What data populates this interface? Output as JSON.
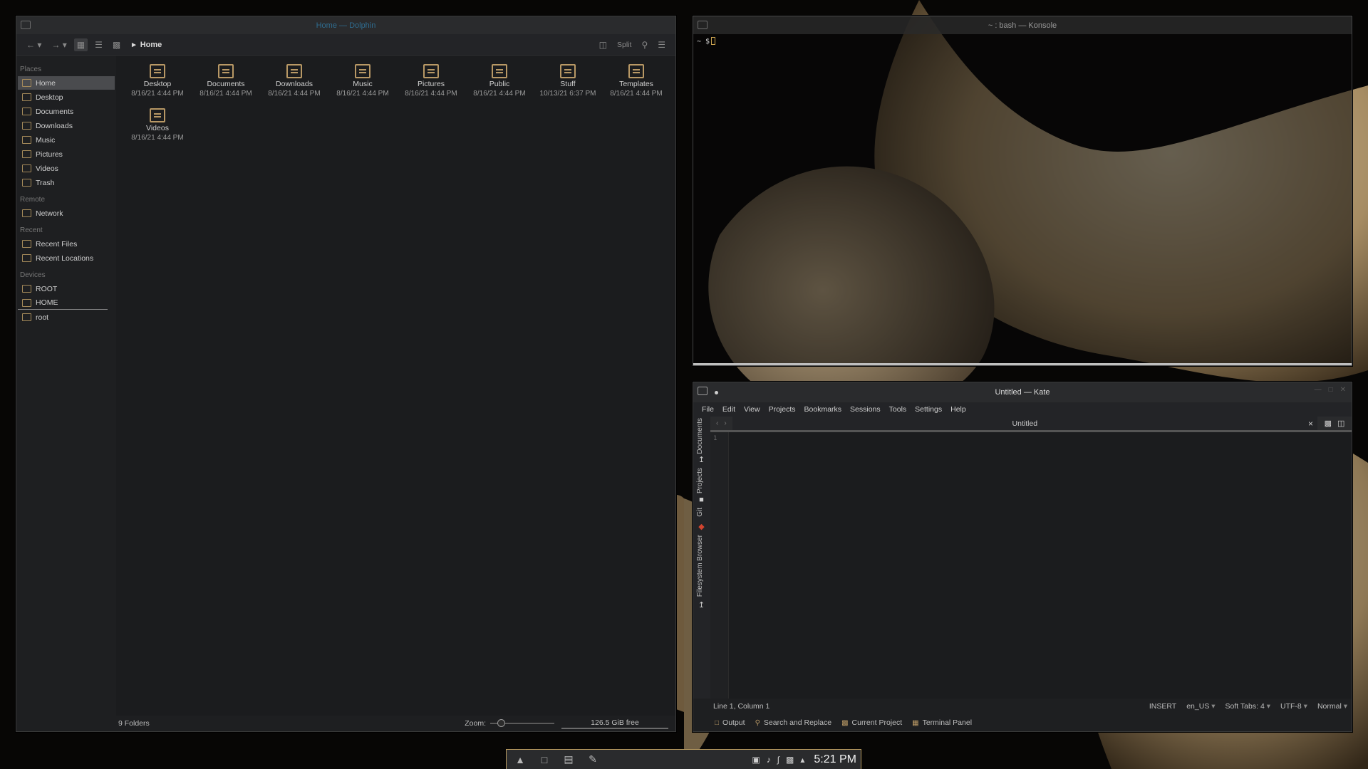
{
  "dolphin": {
    "title": "Home — Dolphin",
    "toolbar": {
      "split_label": "Split",
      "breadcrumb": "Home"
    },
    "places": {
      "sections": [
        {
          "header": "Places",
          "items": [
            "Home",
            "Desktop",
            "Documents",
            "Downloads",
            "Music",
            "Pictures",
            "Videos",
            "Trash"
          ]
        },
        {
          "header": "Remote",
          "items": [
            "Network"
          ]
        },
        {
          "header": "Recent",
          "items": [
            "Recent Files",
            "Recent Locations"
          ]
        },
        {
          "header": "Devices",
          "items": [
            "ROOT",
            "HOME",
            "root"
          ]
        }
      ],
      "selected": "Home"
    },
    "files": [
      {
        "name": "Desktop",
        "date": "8/16/21 4:44 PM"
      },
      {
        "name": "Documents",
        "date": "8/16/21 4:44 PM"
      },
      {
        "name": "Downloads",
        "date": "8/16/21 4:44 PM"
      },
      {
        "name": "Music",
        "date": "8/16/21 4:44 PM"
      },
      {
        "name": "Pictures",
        "date": "8/16/21 4:44 PM"
      },
      {
        "name": "Public",
        "date": "8/16/21 4:44 PM"
      },
      {
        "name": "Stuff",
        "date": "10/13/21 6:37 PM"
      },
      {
        "name": "Templates",
        "date": "8/16/21 4:44 PM"
      },
      {
        "name": "Videos",
        "date": "8/16/21 4:44 PM"
      }
    ],
    "status": {
      "count": "9 Folders",
      "zoom_label": "Zoom:",
      "free": "126.5 GiB free"
    }
  },
  "konsole": {
    "title": "~ : bash — Konsole",
    "prompt": "~ $"
  },
  "kate": {
    "title": "Untitled — Kate",
    "menu": [
      "File",
      "Edit",
      "View",
      "Projects",
      "Bookmarks",
      "Sessions",
      "Tools",
      "Settings",
      "Help"
    ],
    "side_tabs": [
      "Documents",
      "Projects",
      "Git",
      "Filesystem Browser"
    ],
    "doc_tab": "Untitled",
    "line_number": "1",
    "status": {
      "position": "Line 1, Column 1",
      "mode": "INSERT",
      "language": "en_US",
      "indent": "Soft Tabs: 4",
      "encoding": "UTF-8",
      "input_mode": "Normal"
    },
    "tool_views": [
      "Output",
      "Search and Replace",
      "Current Project",
      "Terminal Panel"
    ]
  },
  "taskbar": {
    "clock": "5:21 PM",
    "launchers": [
      "app-launcher-icon",
      "dolphin-icon",
      "konsole-icon",
      "kate-icon"
    ],
    "tray": [
      "clipboard-icon",
      "volume-icon",
      "bluetooth-icon",
      "display-icon",
      "expand-tray-icon"
    ]
  },
  "colors": {
    "accent": "#b89865",
    "window_bg": "#1b1c1e",
    "titlebar": "#2a2b2d"
  }
}
